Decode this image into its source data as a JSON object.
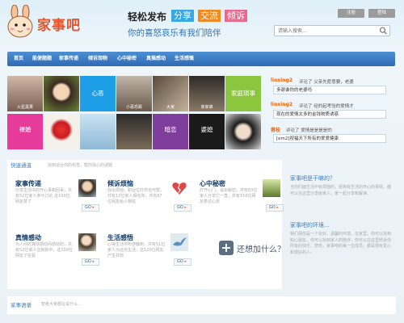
{
  "header": {
    "logo_text": "家事吧",
    "slogan_lead": "轻松发布",
    "slogan_tags": [
      {
        "label": "分享",
        "color": "#39a7e6"
      },
      {
        "label": "交流",
        "color": "#f08a23"
      },
      {
        "label": "倾诉",
        "color": "#e86b8f"
      }
    ],
    "slogan_sub": "你的喜怒哀乐有我们陪伴",
    "register_label": "注册",
    "login_label": "登陆",
    "search_placeholder": "请输入搜索..."
  },
  "nav": {
    "items": [
      "首页",
      "能便题题",
      "家事传递",
      "倾诉观物",
      "心中秘密",
      "真搞感动",
      "生活感慨"
    ]
  },
  "tiles": [
    {
      "label": "火星黑果",
      "kind": "photo"
    },
    {
      "label": "",
      "kind": "photo"
    },
    {
      "label": "心恶",
      "kind": "color",
      "color": "#1d9fe8"
    },
    {
      "label": "小恶恐跌",
      "kind": "photo"
    },
    {
      "label": "大家",
      "kind": "photo"
    },
    {
      "label": "家家谁",
      "kind": "photo"
    },
    {
      "label": "家庭琐事",
      "kind": "color",
      "color": "#8cc63e"
    },
    {
      "label": "裸婚",
      "kind": "color",
      "color": "#e63b9a"
    },
    {
      "label": "",
      "kind": "photo"
    },
    {
      "label": "",
      "kind": "photo"
    },
    {
      "label": "",
      "kind": "photo"
    },
    {
      "label": "暗恋",
      "kind": "color",
      "color": "#7f3d9c"
    },
    {
      "label": "婆媳",
      "kind": "color",
      "color": "#1a1a1a"
    },
    {
      "label": "",
      "kind": "photo"
    }
  ],
  "feed": [
    {
      "user": "linxing2",
      "action": "评论了 父亲先愿意要，老婆",
      "quote": "多谢谁你的老婆吗"
    },
    {
      "user": "linxing2",
      "action": "评论了 经的起考验的爱情才",
      "quote": "现在的爱情太多的金钱物质诱惑"
    },
    {
      "user": "蓉枝",
      "action": "评论了 爱情是是是是的",
      "quote": "[em2]祝福天下所有的爱爱健康"
    }
  ],
  "channels": {
    "head_title": "快速通道",
    "head_sub": "找到适合你的标签，帮你找心的话题",
    "go_label": "GO",
    "items": [
      {
        "title": "家事传递",
        "desc": "分享生活中的开心事和回事，共有52位家人参与讨论 这100位网友赞了"
      },
      {
        "title": "倾诉烦恼",
        "desc": "找出烦恼，职业位打你也可帮，共有12位家人相信你，共有87位网友给小相信"
      },
      {
        "title": "心中秘密",
        "desc": "打开心门，说出秘密，共有83位家人分享它一直，共有156位网友表达心愿"
      },
      {
        "title": "真情感动",
        "desc": "为人间的真情感动而感动的，共有52位家人在默默中，这100位网友了在看"
      },
      {
        "title": "生活感悟",
        "desc": "心得生活中所感触到，共有51位家人为这份生活，这120位网友产生共鸣"
      }
    ],
    "add_label": "还想加什么？"
  },
  "info": {
    "title1": "家事吧是干嘛的？",
    "text1": "当你们面生活中有烦恼时，经常有生活的开心的事情，都可以在这里分享给家人，家一起分享和解读。",
    "title2": "家事吧的环境...",
    "text2": "我们相信是一个友好、温馨的环境。在家里，你可以找到知心朋友，你可以找到家人的陪伴，你可以在这里倾诉你所有的快乐、悲伤，家事吧的每一位成员，都是很有爱心和很好的人。"
  },
  "bottom": {
    "title": "家事语录",
    "sub": "智者大家都在说什么..."
  },
  "colors": {
    "nav_blue": "#3b78c2",
    "accent_orange": "#e5542b",
    "link_blue": "#3e7fc4"
  }
}
